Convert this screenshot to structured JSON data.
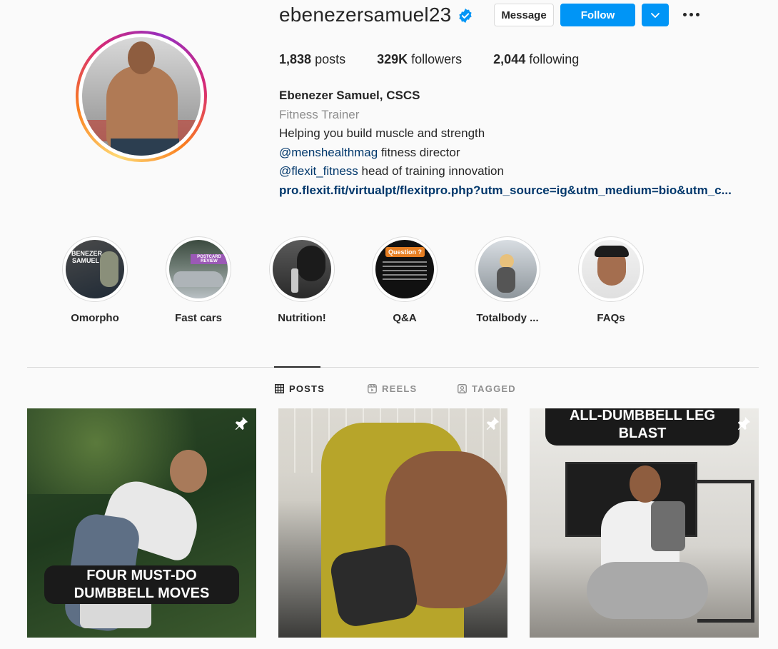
{
  "profile": {
    "username": "ebenezersamuel23",
    "verified": true,
    "buttons": {
      "message": "Message",
      "follow": "Follow"
    },
    "stats": {
      "posts_value": "1,838",
      "posts_label": "posts",
      "followers_value": "329K",
      "followers_label": "followers",
      "following_value": "2,044",
      "following_label": "following"
    },
    "bio": {
      "name": "Ebenezer Samuel, CSCS",
      "category": "Fitness Trainer",
      "line1": "Helping you build muscle and strength",
      "mention1": "@menshealthmag",
      "line2_rest": " fitness director",
      "mention2": "@flexit_fitness",
      "line3_rest": " head of training innovation",
      "link": "pro.flexit.fit/virtualpt/flexitpro.php?utm_source=ig&utm_medium=bio&utm_c..."
    }
  },
  "highlights": [
    {
      "label": "Omorpho",
      "thumb_text": "BENEZER SAMUEL"
    },
    {
      "label": "Fast cars",
      "thumb_text": "POSTCARD REVIEW"
    },
    {
      "label": "Nutrition!",
      "thumb_text": ""
    },
    {
      "label": "Q&A",
      "thumb_text": "Question ?"
    },
    {
      "label": "Totalbody ...",
      "thumb_text": ""
    },
    {
      "label": "FAQs",
      "thumb_text": ""
    }
  ],
  "tabs": [
    {
      "label": "POSTS",
      "icon": "grid-icon",
      "active": true
    },
    {
      "label": "REELS",
      "icon": "reels-icon",
      "active": false
    },
    {
      "label": "TAGGED",
      "icon": "tagged-icon",
      "active": false
    }
  ],
  "posts": [
    {
      "caption": "FOUR MUST-DO DUMBBELL MOVES",
      "pinned": true
    },
    {
      "caption": "",
      "pinned": true
    },
    {
      "caption": "ALL-DUMBBELL LEG BLAST",
      "pinned": true
    }
  ],
  "colors": {
    "accent": "#0095f6",
    "link": "#00376b",
    "muted": "#8e8e8e",
    "border": "#dbdbdb"
  }
}
